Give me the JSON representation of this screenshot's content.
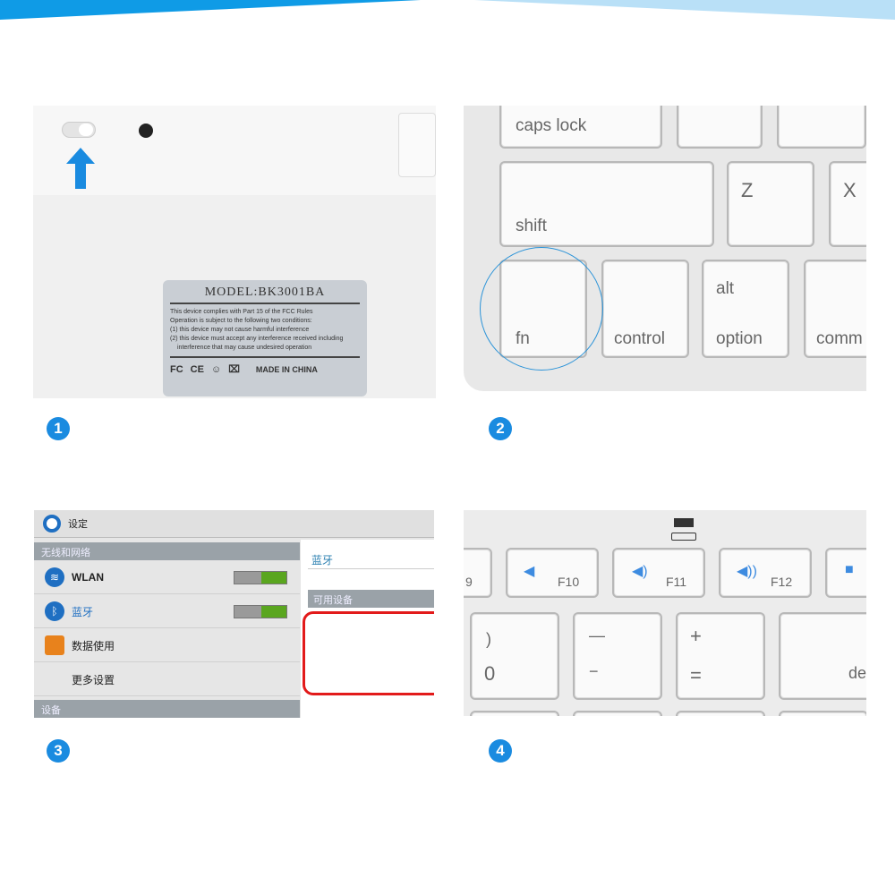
{
  "colors": {
    "accent": "#1a8be0",
    "banner_dark": "#0f9be6",
    "banner_light": "#b9e0f7",
    "highlight_red": "#e21a1a",
    "toggle_on": "#5aa61f"
  },
  "steps": [
    "1",
    "2",
    "3",
    "4"
  ],
  "panel1": {
    "label": {
      "model": "MODEL:BK3001BA",
      "fcc_lines": [
        "This device complies with Part 15 of the FCC Rules",
        "Operation is subject to the following two conditions:",
        "(1) this device may not cause harmful interference",
        "(2) this device must accept any interference received including",
        "interference that may cause undesired operation"
      ],
      "marks": [
        "FC",
        "CE"
      ],
      "origin": "MADE IN CHINA"
    },
    "icons": [
      "power-switch",
      "arrow-up-icon"
    ]
  },
  "panel2": {
    "keys": {
      "caps": "caps lock",
      "z": "Z",
      "x": "X",
      "shift": "shift",
      "fn": "fn",
      "control": "control",
      "alt": "alt",
      "option": "option",
      "command": "comm"
    }
  },
  "panel3": {
    "title": "设定",
    "section_wireless": "无线和网络",
    "wlan": "WLAN",
    "bluetooth": "蓝牙",
    "data_usage": "数据使用",
    "more": "更多设置",
    "section_device": "设备",
    "right_title": "蓝牙",
    "available": "可用设备"
  },
  "panel4": {
    "keys": {
      "f9": "9",
      "f10": "F10",
      "f11": "F11",
      "f12": "F12",
      "zero_top": ")",
      "zero": "0",
      "minus_top": "—",
      "minus": "−",
      "plus": "+",
      "equals": "=",
      "delete": "de"
    }
  }
}
